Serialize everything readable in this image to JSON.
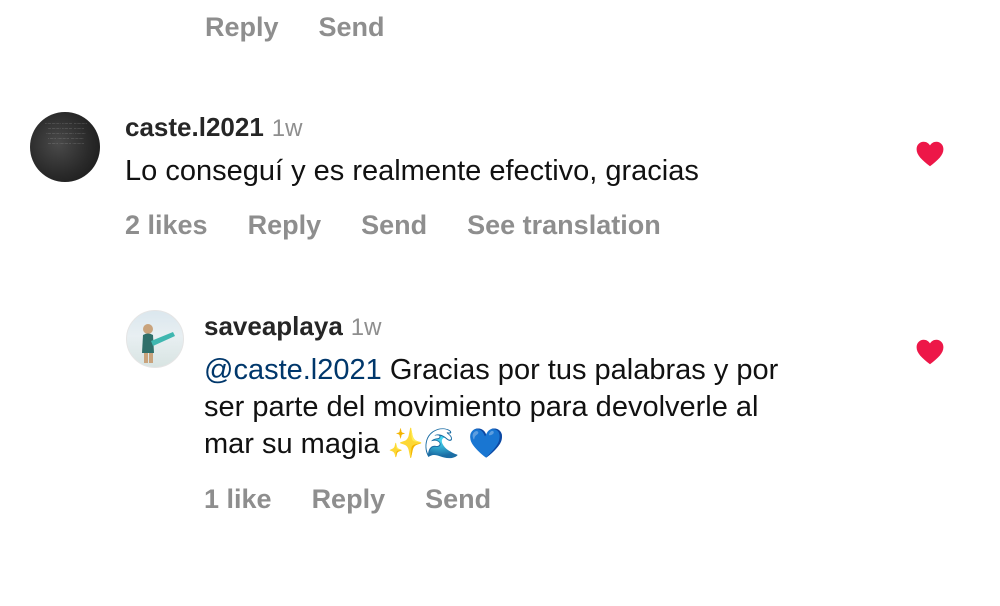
{
  "top_actions": {
    "reply": "Reply",
    "send": "Send"
  },
  "comment1": {
    "username": "caste.l2021",
    "time": "1w",
    "text": "Lo conseguí y es realmente efectivo, gracias",
    "likes": "2 likes",
    "reply": "Reply",
    "send": "Send",
    "translate": "See translation"
  },
  "comment2": {
    "username": "saveaplaya",
    "time": "1w",
    "mention": "@caste.l2021",
    "line1": " Gracias por tus palabras y por",
    "line2": "ser parte del movimiento para devolverle al",
    "line3": "mar su magia ✨🌊 💙",
    "likes": "1 like",
    "reply": "Reply",
    "send": "Send"
  },
  "colors": {
    "heart": "#ed1748",
    "meta_gray": "#8e8e8e",
    "mention_blue": "#00376b"
  },
  "icons": {
    "like": "heart-icon"
  }
}
